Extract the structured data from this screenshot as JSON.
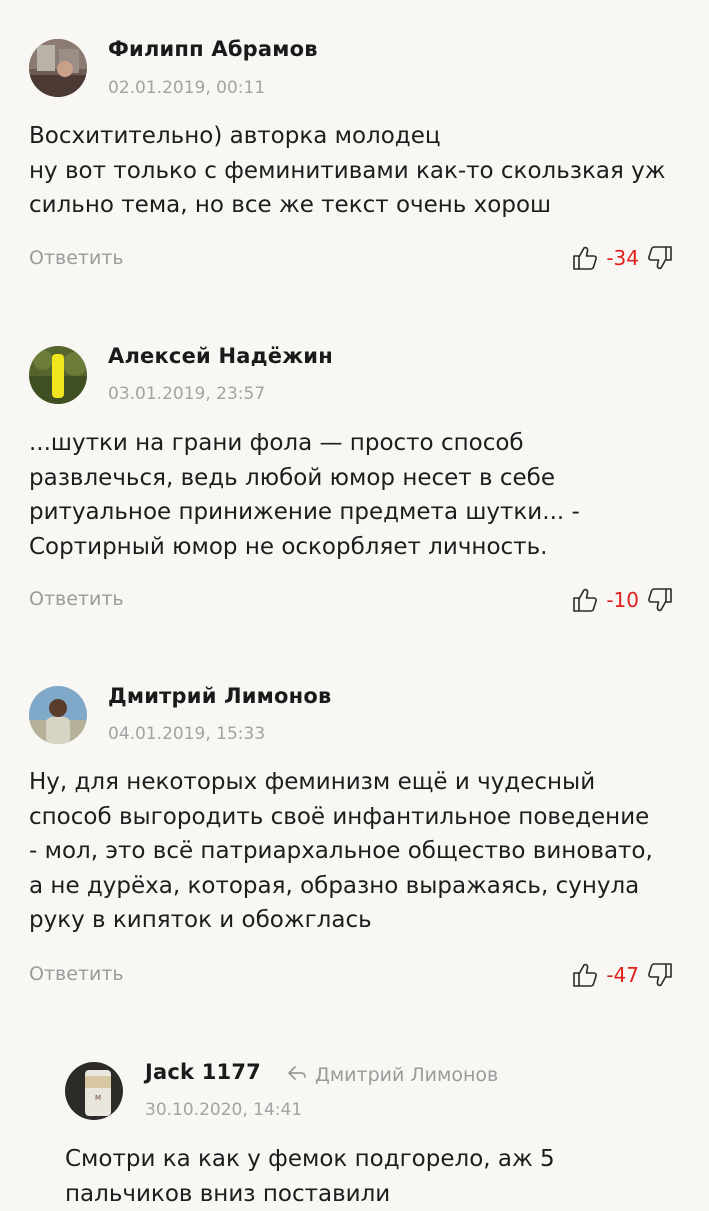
{
  "comments": [
    {
      "author": "Филипп Абрамов",
      "date": "02.01.2019, 00:11",
      "lines": [
        "Восхитительно) авторка молодец",
        "ну вот только с феминитивами как-то скользкая уж",
        "сильно тема, но все же текст очень хорош"
      ],
      "reply_label": "Ответить",
      "score": "-34",
      "avatar_icon": "avatar-photo-window"
    },
    {
      "author": "Алексей Надёжин",
      "date": "03.01.2019, 23:57",
      "lines": [
        "...шутки на грани фола — просто способ",
        "развлечься, ведь любой юмор несет в себе",
        "ритуальное принижение предмета шутки... -",
        "Сортирный юмор не оскорбляет личность."
      ],
      "reply_label": "Ответить",
      "score": "-10",
      "avatar_icon": "avatar-photo-yellow-object"
    },
    {
      "author": "Дмитрий Лимонов",
      "date": "04.01.2019, 15:33",
      "lines": [
        "Ну, для некоторых феминизм ещё и чудесный",
        "способ выгородить своё инфантильное поведение",
        "- мол, это всё патриархальное общество виновато,",
        "а не дурёха, которая, образно выражаясь, сунула",
        "руку в кипяток и обожглась"
      ],
      "reply_label": "Ответить",
      "score": "-47",
      "avatar_icon": "avatar-photo-person"
    }
  ],
  "reply": {
    "author": "Jack 1177",
    "reply_to": "Дмитрий Лимонов",
    "date": "30.10.2020, 14:41",
    "lines": [
      "Смотри ка как у фемок подгорело, аж 5",
      "пальчиков вниз поставили"
    ],
    "avatar_icon": "avatar-photo-cup"
  },
  "colors": {
    "background": "#f8f7f3",
    "score_negative": "#e0201c",
    "muted": "#9b9b9b"
  }
}
